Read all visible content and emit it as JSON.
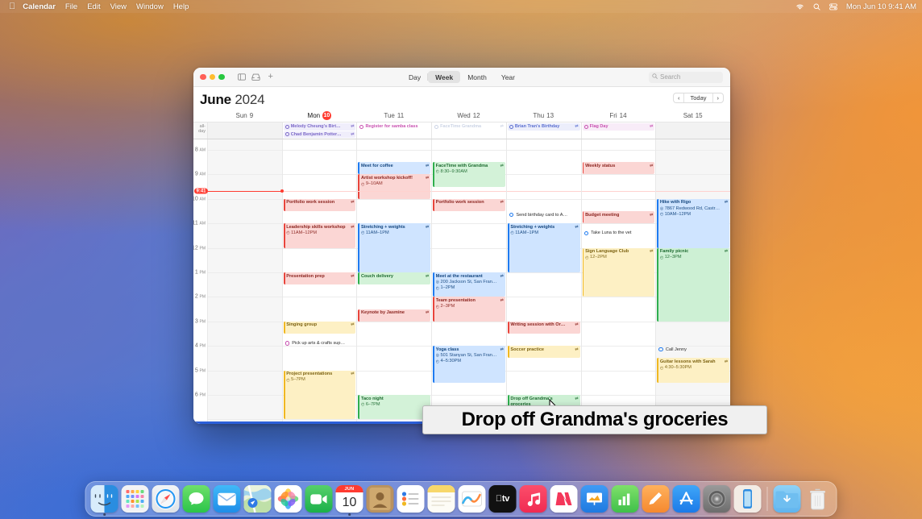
{
  "menubar": {
    "apple_icon": "apple-logo-icon",
    "items": [
      {
        "label": "Calendar",
        "bold": true
      },
      {
        "label": "File",
        "bold": false
      },
      {
        "label": "Edit",
        "bold": false
      },
      {
        "label": "View",
        "bold": false
      },
      {
        "label": "Window",
        "bold": false
      },
      {
        "label": "Help",
        "bold": false
      }
    ],
    "status_icons": [
      "wifi-icon",
      "search-icon",
      "control-center-icon"
    ],
    "clock": "Mon Jun 10  9:41 AM"
  },
  "window": {
    "toolbar": {
      "traffic_lights": [
        "close-button",
        "minimize-button",
        "zoom-button"
      ],
      "calendar_list_icon": "calendar-sidebar-icon",
      "inbox_icon": "inbox-icon",
      "add_icon": "+",
      "view_segments": [
        {
          "label": "Day",
          "active": false
        },
        {
          "label": "Week",
          "active": true
        },
        {
          "label": "Month",
          "active": false
        },
        {
          "label": "Year",
          "active": false
        }
      ],
      "search_placeholder": "Search"
    },
    "title": {
      "month": "June",
      "year": "2024"
    },
    "nav": {
      "prev": "‹",
      "today": "Today",
      "next": "›"
    }
  },
  "calendar": {
    "all_day_label": "all-day",
    "days": [
      {
        "weekday": "Sun",
        "num": "9",
        "today": false,
        "weekend": true
      },
      {
        "weekday": "Mon",
        "num": "10",
        "today": true,
        "weekend": false
      },
      {
        "weekday": "Tue",
        "num": "11",
        "today": false,
        "weekend": false
      },
      {
        "weekday": "Wed",
        "num": "12",
        "today": false,
        "weekend": false
      },
      {
        "weekday": "Thu",
        "num": "13",
        "today": false,
        "weekend": false
      },
      {
        "weekday": "Fri",
        "num": "14",
        "today": false,
        "weekend": false
      },
      {
        "weekday": "Sat",
        "num": "15",
        "today": false,
        "weekend": true
      }
    ],
    "hours": [
      {
        "label": "8",
        "ampm": "AM"
      },
      {
        "label": "9",
        "ampm": "AM"
      },
      {
        "label": "10",
        "ampm": "AM"
      },
      {
        "label": "11",
        "ampm": "AM"
      },
      {
        "label": "12",
        "ampm": "PM"
      },
      {
        "label": "1",
        "ampm": "PM"
      },
      {
        "label": "2",
        "ampm": "PM"
      },
      {
        "label": "3",
        "ampm": "PM"
      },
      {
        "label": "4",
        "ampm": "PM"
      },
      {
        "label": "5",
        "ampm": "PM"
      },
      {
        "label": "6",
        "ampm": "PM"
      }
    ],
    "now_time": "9:41",
    "all_day_events": [
      {
        "day": 1,
        "title": "Melody Cheung's Birt…",
        "color": "#7b68c8",
        "bg": "#f0eefb",
        "repeat": true,
        "faded": false
      },
      {
        "day": 1,
        "title": "Chad Benjamin Potter…",
        "color": "#7b68c8",
        "bg": "#f0eefb",
        "repeat": true,
        "faded": false
      },
      {
        "day": 2,
        "title": "Register for samba class",
        "color": "#c850b0",
        "bg": "#ffffff",
        "repeat": false,
        "faded": false
      },
      {
        "day": 3,
        "title": "FaceTime Grandma",
        "color": "#b9c4dc",
        "bg": "#ffffff",
        "repeat": true,
        "faded": true
      },
      {
        "day": 4,
        "title": "Brian Tran's Birthday",
        "color": "#5b6fd0",
        "bg": "#eceefb",
        "repeat": true,
        "faded": false
      },
      {
        "day": 5,
        "title": "Flag Day",
        "color": "#c850b0",
        "bg": "#f8ecf8",
        "repeat": true,
        "faded": false
      }
    ],
    "events": [
      {
        "day": 2,
        "title": "Meet for coffee",
        "start": "8:30",
        "end": "9:00",
        "time_text": "",
        "location": "",
        "color": "#1f7bf0",
        "bg": "#d3e6ff",
        "text": "#15477f",
        "repeat": true,
        "clip": true
      },
      {
        "day": 2,
        "title": "Artist workshop kickoff!",
        "start": "9:00",
        "end": "10:00",
        "time_text": "9–10AM",
        "location": "",
        "color": "#e8453c",
        "bg": "#fbd6d4",
        "text": "#8c2520",
        "repeat": true,
        "clip": true
      },
      {
        "day": 3,
        "title": "FaceTime with Grandma",
        "start": "8:30",
        "end": "9:30",
        "time_text": "8:30–9:30AM",
        "location": "",
        "color": "#2fae4e",
        "bg": "#d3f2d8",
        "text": "#1d6b30",
        "repeat": true,
        "clip": true
      },
      {
        "day": 5,
        "title": "Weekly status",
        "start": "8:30",
        "end": "9:00",
        "time_text": "",
        "location": "",
        "color": "#e8453c",
        "bg": "#fbd6d4",
        "text": "#8c2520",
        "repeat": true,
        "clip": true
      },
      {
        "day": 1,
        "title": "Portfolio work session",
        "start": "10:00",
        "end": "10:30",
        "time_text": "",
        "location": "",
        "color": "#e8453c",
        "bg": "#fbd6d4",
        "text": "#8c2520",
        "repeat": true,
        "clip": true
      },
      {
        "day": 3,
        "title": "Portfolio work session",
        "start": "10:00",
        "end": "10:30",
        "time_text": "",
        "location": "",
        "color": "#e8453c",
        "bg": "#fbd6d4",
        "text": "#8c2520",
        "repeat": true,
        "clip": true
      },
      {
        "day": 6,
        "title": "Hike with Rigo",
        "start": "10:00",
        "end": "12:00",
        "time_text": "10AM–12PM",
        "location": "7867 Redwood Rd, Castr…",
        "color": "#1f7bf0",
        "bg": "#cfe4ff",
        "text": "#15477f",
        "repeat": true,
        "clip": true
      },
      {
        "day": 5,
        "title": "Budget meeting",
        "start": "10:30",
        "end": "11:00",
        "time_text": "",
        "location": "",
        "color": "#e8453c",
        "bg": "#fbd6d4",
        "text": "#8c2520",
        "repeat": true,
        "clip": true
      },
      {
        "day": 1,
        "title": "Leadership skills workshop",
        "start": "11:00",
        "end": "12:00",
        "time_text": "11AM–12PM",
        "location": "",
        "color": "#e8453c",
        "bg": "#fbd6d4",
        "text": "#8c2520",
        "repeat": true,
        "clip": false
      },
      {
        "day": 2,
        "title": "Stretching + weights",
        "start": "11:00",
        "end": "13:00",
        "time_text": "11AM–1PM",
        "location": "",
        "color": "#1f7bf0",
        "bg": "#cfe4ff",
        "text": "#15477f",
        "repeat": true,
        "clip": true
      },
      {
        "day": 4,
        "title": "Stretching + weights",
        "start": "11:00",
        "end": "13:00",
        "time_text": "11AM–1PM",
        "location": "",
        "color": "#1f7bf0",
        "bg": "#cfe4ff",
        "text": "#15477f",
        "repeat": true,
        "clip": true
      },
      {
        "day": 5,
        "title": "Sign Language Club",
        "start": "12:00",
        "end": "14:00",
        "time_text": "12–2PM",
        "location": "",
        "color": "#f0b822",
        "bg": "#fdf0c4",
        "text": "#7d6312",
        "repeat": true,
        "clip": true
      },
      {
        "day": 6,
        "title": "Family picnic",
        "start": "12:00",
        "end": "15:00",
        "time_text": "12–3PM",
        "location": "",
        "color": "#2fae4e",
        "bg": "#cdf0d4",
        "text": "#1d6b30",
        "repeat": true,
        "clip": true
      },
      {
        "day": 1,
        "title": "Presentation prep",
        "start": "13:00",
        "end": "13:30",
        "time_text": "",
        "location": "",
        "color": "#e8453c",
        "bg": "#fbd6d4",
        "text": "#8c2520",
        "repeat": true,
        "clip": true
      },
      {
        "day": 2,
        "title": "Couch delivery",
        "start": "13:00",
        "end": "13:30",
        "time_text": "",
        "location": "",
        "color": "#2fae4e",
        "bg": "#d3f2d8",
        "text": "#1d6b30",
        "repeat": true,
        "clip": true
      },
      {
        "day": 3,
        "title": "Meet at the restaurant",
        "start": "13:00",
        "end": "14:00",
        "time_text": "1–2PM",
        "location": "200 Jackson St, San Fran…",
        "color": "#1f7bf0",
        "bg": "#cfe4ff",
        "text": "#15477f",
        "repeat": true,
        "clip": true
      },
      {
        "day": 3,
        "title": "Team presentation",
        "start": "14:00",
        "end": "15:00",
        "time_text": "2–3PM",
        "location": "",
        "color": "#e8453c",
        "bg": "#fbd6d4",
        "text": "#8c2520",
        "repeat": true,
        "clip": true
      },
      {
        "day": 2,
        "title": "Keynote by Jasmine",
        "start": "14:30",
        "end": "15:00",
        "time_text": "",
        "location": "",
        "color": "#e8453c",
        "bg": "#fbd6d4",
        "text": "#8c2520",
        "repeat": true,
        "clip": true
      },
      {
        "day": 1,
        "title": "Singing group",
        "start": "15:00",
        "end": "15:30",
        "time_text": "",
        "location": "",
        "color": "#f0b822",
        "bg": "#fdf0c4",
        "text": "#7d6312",
        "repeat": true,
        "clip": true
      },
      {
        "day": 4,
        "title": "Writing session with Or…",
        "start": "15:00",
        "end": "15:30",
        "time_text": "",
        "location": "",
        "color": "#e8453c",
        "bg": "#fbd6d4",
        "text": "#8c2520",
        "repeat": true,
        "clip": true
      },
      {
        "day": 3,
        "title": "Yoga class",
        "start": "16:00",
        "end": "17:30",
        "time_text": "4–5:30PM",
        "location": "501 Stanyan St, San Fran…",
        "color": "#1f7bf0",
        "bg": "#cfe4ff",
        "text": "#15477f",
        "repeat": true,
        "clip": true
      },
      {
        "day": 4,
        "title": "Soccer practice",
        "start": "16:00",
        "end": "16:30",
        "time_text": "",
        "location": "",
        "color": "#f0b822",
        "bg": "#fdf0c4",
        "text": "#7d6312",
        "repeat": true,
        "clip": true
      },
      {
        "day": 6,
        "title": "Guitar lessons with Sarah",
        "start": "16:30",
        "end": "17:30",
        "time_text": "4:30–5:30PM",
        "location": "",
        "color": "#f0b822",
        "bg": "#fdf0c4",
        "text": "#7d6312",
        "repeat": true,
        "clip": false
      },
      {
        "day": 1,
        "title": "Project presentations",
        "start": "17:00",
        "end": "19:00",
        "time_text": "5–7PM",
        "location": "",
        "color": "#f0b822",
        "bg": "#fdf0c4",
        "text": "#7d6312",
        "repeat": true,
        "clip": true
      },
      {
        "day": 4,
        "title": "Drop off Grandma's groceries",
        "start": "18:00",
        "end": "18:45",
        "time_text": "",
        "location": "",
        "color": "#2fae4e",
        "bg": "#cdf0d4",
        "text": "#1d6b30",
        "repeat": true,
        "clip": false
      },
      {
        "day": 2,
        "title": "Taco night",
        "start": "18:00",
        "end": "19:00",
        "time_text": "6–7PM",
        "location": "",
        "color": "#2fae4e",
        "bg": "#d3f2d8",
        "text": "#1d6b30",
        "repeat": false,
        "clip": true
      }
    ],
    "reminders": [
      {
        "day": 4,
        "title": "Send birthday card to A…",
        "at": "10:30",
        "color": "#1f7bf0"
      },
      {
        "day": 5,
        "title": "Take Luna to the vet",
        "at": "11:15",
        "color": "#1f7bf0"
      },
      {
        "day": 1,
        "title": "Pick up arts & crafts sup…",
        "at": "15:45",
        "color": "#c850b0"
      },
      {
        "day": 6,
        "title": "Call Jenny",
        "at": "16:00",
        "color": "#1f7bf0"
      }
    ]
  },
  "tooltip": {
    "text": "Drop off Grandma's groceries"
  },
  "dock": {
    "items": [
      {
        "name": "finder",
        "glyph": "",
        "bg": "linear-gradient(180deg,#4aa8f0,#2a8de0)",
        "dot": true
      },
      {
        "name": "launchpad",
        "glyph": "",
        "bg": "#f3f3f5",
        "dot": false
      },
      {
        "name": "safari",
        "glyph": "",
        "bg": "linear-gradient(180deg,#f2f4f6,#dfe3e8)",
        "dot": false
      },
      {
        "name": "messages",
        "glyph": "",
        "bg": "linear-gradient(180deg,#6ee06a,#2bc44a)",
        "dot": false
      },
      {
        "name": "mail",
        "glyph": "",
        "bg": "linear-gradient(180deg,#41b9f8,#1e8de8)",
        "dot": false
      },
      {
        "name": "maps",
        "glyph": "",
        "bg": "linear-gradient(170deg,#cfe7a8,#9fd0e8)",
        "dot": false
      },
      {
        "name": "photos",
        "glyph": "",
        "bg": "#ffffff",
        "dot": false
      },
      {
        "name": "facetime",
        "glyph": "",
        "bg": "linear-gradient(180deg,#56d06a,#1bb04a)",
        "dot": false
      },
      {
        "name": "calendar",
        "glyph": "",
        "bg": "#ffffff",
        "dot": true,
        "month": "JUN",
        "day": "10"
      },
      {
        "name": "contacts",
        "glyph": "",
        "bg": "linear-gradient(180deg,#c8a272,#a9804e)",
        "dot": false
      },
      {
        "name": "reminders",
        "glyph": "",
        "bg": "#ffffff",
        "dot": false
      },
      {
        "name": "notes",
        "glyph": "",
        "bg": "linear-gradient(180deg,#fde9a8,#f8d873)",
        "dot": false
      },
      {
        "name": "freeform",
        "glyph": "",
        "bg": "#ffffff",
        "dot": false
      },
      {
        "name": "apple-tv",
        "glyph": "tv",
        "bg": "#111111",
        "dot": false
      },
      {
        "name": "music",
        "glyph": "",
        "bg": "linear-gradient(180deg,#fc4e6b,#f02b52)",
        "dot": false
      },
      {
        "name": "news",
        "glyph": "N",
        "bg": "#ffffff",
        "dot": false
      },
      {
        "name": "keynote",
        "glyph": "",
        "bg": "linear-gradient(180deg,#3f9bf5,#1f7ae0)",
        "dot": false
      },
      {
        "name": "numbers",
        "glyph": "",
        "bg": "linear-gradient(180deg,#7fe06a,#3fc04a)",
        "dot": false
      },
      {
        "name": "pages",
        "glyph": "",
        "bg": "linear-gradient(180deg,#ffb15c,#f5892f)",
        "dot": false
      },
      {
        "name": "app-store",
        "glyph": "A",
        "bg": "linear-gradient(180deg,#3fa6f8,#1b7ae8)",
        "dot": false
      },
      {
        "name": "system-settings",
        "glyph": "",
        "bg": "linear-gradient(180deg,#9a9a9a,#6d6d6d)",
        "dot": false
      },
      {
        "name": "iphone-mirroring",
        "glyph": "",
        "bg": "linear-gradient(180deg,#f6efe8,#e8dfd4)",
        "dot": false
      },
      {
        "name": "separator",
        "glyph": "",
        "bg": "",
        "dot": false
      },
      {
        "name": "downloads-folder",
        "glyph": "",
        "bg": "linear-gradient(180deg,#8fd2f7,#5fb4ee)",
        "dot": false
      },
      {
        "name": "trash",
        "glyph": "",
        "bg": "linear-gradient(180deg,#f2f2f2,#dcdcdc)",
        "dot": false
      }
    ]
  }
}
